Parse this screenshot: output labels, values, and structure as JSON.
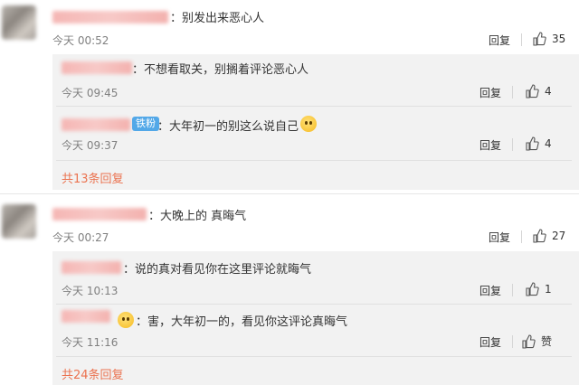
{
  "comments": [
    {
      "text": "：别发出来恶心人",
      "time": "今天 00:52",
      "reply_label": "回复",
      "likes": "35",
      "replies": [
        {
          "text": "：不想看取关，别搁着评论恶心人",
          "time": "今天 09:45",
          "reply_label": "回复",
          "likes": "4"
        },
        {
          "badge": "铁粉",
          "text": "：大年初一的别这么说自己",
          "time": "今天 09:37",
          "reply_label": "回复",
          "likes": "4"
        }
      ],
      "more_label": "共13条回复"
    },
    {
      "text": "：大晚上的 真晦气",
      "time": "今天 00:27",
      "reply_label": "回复",
      "likes": "27",
      "replies": [
        {
          "text": "：说的真对看见你在这里评论就晦气",
          "time": "今天 10:13",
          "reply_label": "回复",
          "likes": "1"
        },
        {
          "text": "：害，大年初一的，看见你这评论真晦气",
          "time": "今天 11:16",
          "reply_label": "回复",
          "likes": "赞"
        }
      ],
      "more_label": "共24条回复"
    }
  ],
  "icons": {
    "like": "thumbs-up-icon",
    "emoji": "pleading-face-emoji-icon"
  },
  "colors": {
    "more_link": "#eb7350",
    "badge": "#53a8e8",
    "panel": "#f2f2f2"
  }
}
